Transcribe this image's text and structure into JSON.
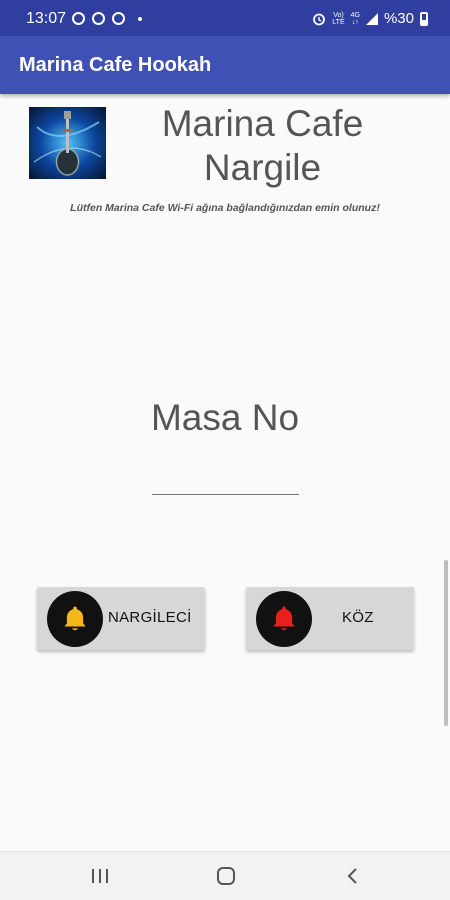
{
  "status_bar": {
    "time": "13:07",
    "battery": "%30",
    "network_top": "Vo)",
    "network_bottom": "LTE",
    "data_top": "4G",
    "data_bottom": "↓↑"
  },
  "app_bar": {
    "title": "Marina Cafe Hookah"
  },
  "header": {
    "cafe_name": "Marina Cafe Nargile",
    "notice": "Lütfen Marina Cafe Wi-Fi ağına bağlandığınızdan emin olunuz!"
  },
  "table": {
    "label": "Masa No",
    "value": "",
    "placeholder": ""
  },
  "buttons": {
    "hookah_label": "NARGİLECİ",
    "koz_label": "KÖZ"
  },
  "colors": {
    "app_bar": "#3f51b5",
    "status_bar": "#303f9f",
    "bell_hookah": "#f5b81c",
    "bell_koz": "#e8201c",
    "button_bg": "#d6d7d7"
  },
  "icons": {
    "logo": "hookah-logo",
    "hookah_bell": "bell-icon-yellow",
    "koz_bell": "bell-icon-red",
    "nav_recent": "recent-apps-icon",
    "nav_home": "home-icon",
    "nav_back": "back-icon"
  }
}
